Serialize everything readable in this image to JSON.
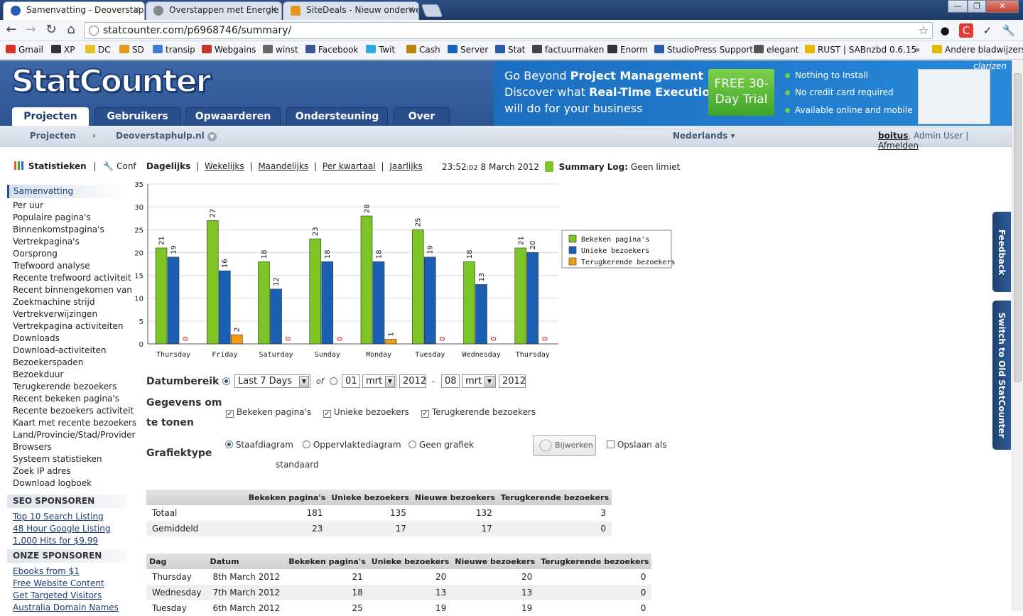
{
  "browser": {
    "tabs": [
      {
        "title": "Samenvatting - Deoverstap",
        "active": true,
        "icon_color": "#2a5db0"
      },
      {
        "title": "Overstappen met Energie | E",
        "active": false,
        "icon_color": "#777777"
      },
      {
        "title": "SiteDeals - Nieuw onderwer",
        "active": false,
        "icon_color": "#e39b1c"
      }
    ],
    "url": "statcounter.com/p6968746/summary/",
    "bookmarks": [
      {
        "label": "Gmail",
        "color": "#d93025"
      },
      {
        "label": "XP",
        "color": "#333333"
      },
      {
        "label": "DC",
        "color": "#e6c229"
      },
      {
        "label": "SD",
        "color": "#e39b1c"
      },
      {
        "label": "transip",
        "color": "#3d7fd1"
      },
      {
        "label": "Webgains",
        "color": "#c0392b"
      },
      {
        "label": "winst",
        "color": "#666666"
      },
      {
        "label": "Facebook",
        "color": "#3b5998"
      },
      {
        "label": "Twit",
        "color": "#2fa8e0"
      },
      {
        "label": "Cash",
        "color": "#b8860b"
      },
      {
        "label": "Server",
        "color": "#1565c0"
      },
      {
        "label": "Stat",
        "color": "#2a5db0"
      },
      {
        "label": "factuurmaken",
        "color": "#444444"
      },
      {
        "label": "Enorm",
        "color": "#333333"
      },
      {
        "label": "StudioPress Support",
        "color": "#2a5db0"
      },
      {
        "label": "elegant",
        "color": "#555555"
      },
      {
        "label": "RUST | SABnzbd 0.6.15",
        "color": "#e6b800"
      },
      {
        "label": "Andere bladwijzers",
        "color": "#e6b800"
      }
    ]
  },
  "site": {
    "logo": "StatCounter",
    "nav_tabs": [
      "Projecten",
      "Gebruikers",
      "Opwaarderen",
      "Ondersteuning",
      "Over"
    ],
    "banner": {
      "line1_normal": "Go Beyond ",
      "line1_bold": "Project Management",
      "line2_normal": "Discover what ",
      "line2_bold": "Real-Time Execution",
      "line3": "will do for your business",
      "trial": "FREE 30-Day Trial",
      "bullets": [
        "Nothing to Install",
        "No credit card required",
        "Available online and mobile"
      ],
      "brand": "clarizen"
    },
    "subnav": {
      "projects": "Projecten",
      "sep": "›",
      "project": "Deoverstaphulp.nl",
      "language": "Nederlands",
      "user": "boitus",
      "role": ", Admin User",
      "logout": "Afmelden"
    }
  },
  "sidebar": {
    "stats_label": "Statistieken",
    "config_label": "Conf",
    "active": "Samenvatting",
    "items": [
      "Per uur",
      "Populaire pagina's",
      "Binnenkomstpagina's",
      "Vertrekpagina's",
      "Oorsprong",
      "Trefwoord analyse",
      "Recente trefwoord activiteit",
      "Recent binnengekomen van",
      "Zoekmachine strijd",
      "Vertrekverwijzingen",
      "Vertrekpagina activiteiten",
      "Downloads",
      "Download-activiteiten",
      "Bezoekerspaden",
      "Bezoekduur",
      "Terugkerende bezoekers",
      "Recent bekeken pagina's",
      "Recente bezoekers activiteit",
      "Kaart met recente bezoekers",
      "Land/Provincie/Stad/Provider",
      "Browsers",
      "Systeem statistieken",
      "Zoek IP adres",
      "Download logboek"
    ],
    "seo_header": "SEO SPONSOREN",
    "seo_links": [
      "Top 10 Search Listing",
      "48 Hour Google Listing",
      "1,000 Hits for $9.99"
    ],
    "sponsor_header": "ONZE SPONSOREN",
    "sponsor_links": [
      "Ebooks from $1",
      "Free Website Content",
      "Get Targeted Visitors",
      "Australia Domain Names"
    ]
  },
  "periods": [
    "Dagelijks",
    "Wekelijks",
    "Maandelijks",
    "Per kwartaal",
    "Jaarlijks"
  ],
  "status": {
    "time": "23:52",
    "seconds": ":02",
    "date": "8 March 2012",
    "log_label": "Summary Log:",
    "log_value": "Geen limiet"
  },
  "chart_data": {
    "type": "bar",
    "categories": [
      "Thursday",
      "Friday",
      "Saturday",
      "Sunday",
      "Monday",
      "Tuesday",
      "Wednesday",
      "Thursday"
    ],
    "series": [
      {
        "name": "Bekeken pagina's",
        "color": "#7dc524",
        "values": [
          21,
          27,
          18,
          23,
          28,
          25,
          18,
          21
        ]
      },
      {
        "name": "Unieke bezoekers",
        "color": "#1a5fb4",
        "values": [
          19,
          16,
          12,
          18,
          18,
          19,
          13,
          20
        ]
      },
      {
        "name": "Terugkerende bezoekers",
        "color": "#f39c12",
        "values": [
          0,
          2,
          0,
          0,
          1,
          0,
          0,
          0
        ]
      }
    ],
    "ylim": [
      0,
      35
    ],
    "yticks": [
      0,
      5,
      10,
      15,
      20,
      25,
      30,
      35
    ],
    "grid": true,
    "legend": "right"
  },
  "form": {
    "date_range_label": "Datumbereik",
    "range_value": "Last 7 Days",
    "of": "of",
    "from_day": "01",
    "from_month": "mrt",
    "from_year": "2012",
    "dash": "-",
    "to_day": "08",
    "to_month": "mrt",
    "to_year": "2012",
    "data_label_1": "Gegevens om",
    "data_label_2": "te tonen",
    "check_1": "Bekeken pagina's",
    "check_2": "Unieke bezoekers",
    "check_3": "Terugkerende bezoekers",
    "graph_label": "Grafiektype",
    "graph_1": "Staafdiagram",
    "graph_2": "Oppervlaktediagram",
    "graph_3": "Geen grafiek",
    "update": "Bijwerken",
    "save_as": "Opslaan als",
    "standard": "standaard"
  },
  "summary_table": {
    "headers": [
      "",
      "Bekeken pagina's",
      "Unieke bezoekers",
      "Nieuwe bezoekers",
      "Terugkerende bezoekers"
    ],
    "rows": [
      [
        "Totaal",
        "181",
        "135",
        "132",
        "3"
      ],
      [
        "Gemiddeld",
        "23",
        "17",
        "17",
        "0"
      ]
    ]
  },
  "daily_table": {
    "headers": [
      "Dag",
      "Datum",
      "Bekeken pagina's",
      "Unieke bezoekers",
      "Nieuwe bezoekers",
      "Terugkerende bezoekers"
    ],
    "rows": [
      [
        "Thursday",
        "8th March 2012",
        "21",
        "20",
        "20",
        "0"
      ],
      [
        "Wednesday",
        "7th March 2012",
        "18",
        "13",
        "13",
        "0"
      ],
      [
        "Tuesday",
        "6th March 2012",
        "25",
        "19",
        "19",
        "0"
      ]
    ]
  },
  "side_tabs": {
    "feedback": "Feedback",
    "old": "Switch to Old StatCounter"
  }
}
